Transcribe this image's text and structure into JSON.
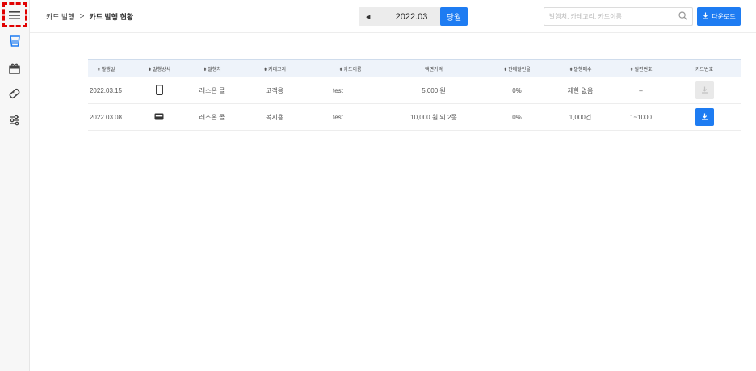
{
  "colors": {
    "accent": "#1e7cf2",
    "highlight": "#e00000"
  },
  "sidebar": {
    "items": [
      {
        "icon": "menu-icon"
      },
      {
        "icon": "cup-icon"
      },
      {
        "icon": "gift-icon"
      },
      {
        "icon": "ticket-icon"
      },
      {
        "icon": "sliders-icon"
      }
    ]
  },
  "breadcrumb": {
    "parent": "카드 발행",
    "separator": ">",
    "current": "카드 발행 현황"
  },
  "month_nav": {
    "prev": "◀",
    "month": "2022.03",
    "next": "▶"
  },
  "today_label": "당월",
  "search": {
    "placeholder": "발행처, 카테고리, 카드이름",
    "value": ""
  },
  "download_label": "다운로드",
  "table": {
    "headers": [
      "발행일",
      "발행방식",
      "발행처",
      "카테고리",
      "카드이름",
      "액면가격",
      "판매할인율",
      "발행매수",
      "일련번호",
      "카드번호"
    ],
    "sortable": [
      true,
      true,
      true,
      true,
      true,
      false,
      true,
      true,
      true,
      false
    ],
    "rows": [
      {
        "date": "2022.03.15",
        "method_icon": "mobile-icon",
        "issuer": "레소온 몰",
        "category": "고객용",
        "name": "test",
        "price": "5,000 원",
        "discount": "0%",
        "count": "제한 없음",
        "serial": "–",
        "download_enabled": false
      },
      {
        "date": "2022.03.08",
        "method_icon": "card-icon",
        "issuer": "레소온 몰",
        "category": "복지용",
        "name": "test",
        "price": "10,000 원 외 2종",
        "discount": "0%",
        "count": "1,000건",
        "serial": "1~1000",
        "download_enabled": true
      }
    ]
  }
}
